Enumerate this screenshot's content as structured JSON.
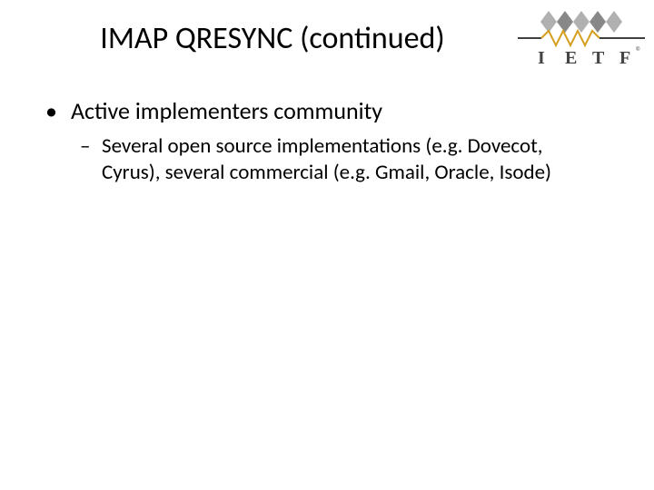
{
  "slide": {
    "title": "IMAP QRESYNC (continued)",
    "bullets": [
      {
        "text": "Active implementers community",
        "children": [
          {
            "text": "Several open source implementations (e.g. Dovecot, Cyrus), several commercial (e.g. Gmail, Oracle, Isode)"
          }
        ]
      }
    ]
  },
  "logo": {
    "letters": [
      "I",
      "E",
      "T",
      "F"
    ]
  }
}
